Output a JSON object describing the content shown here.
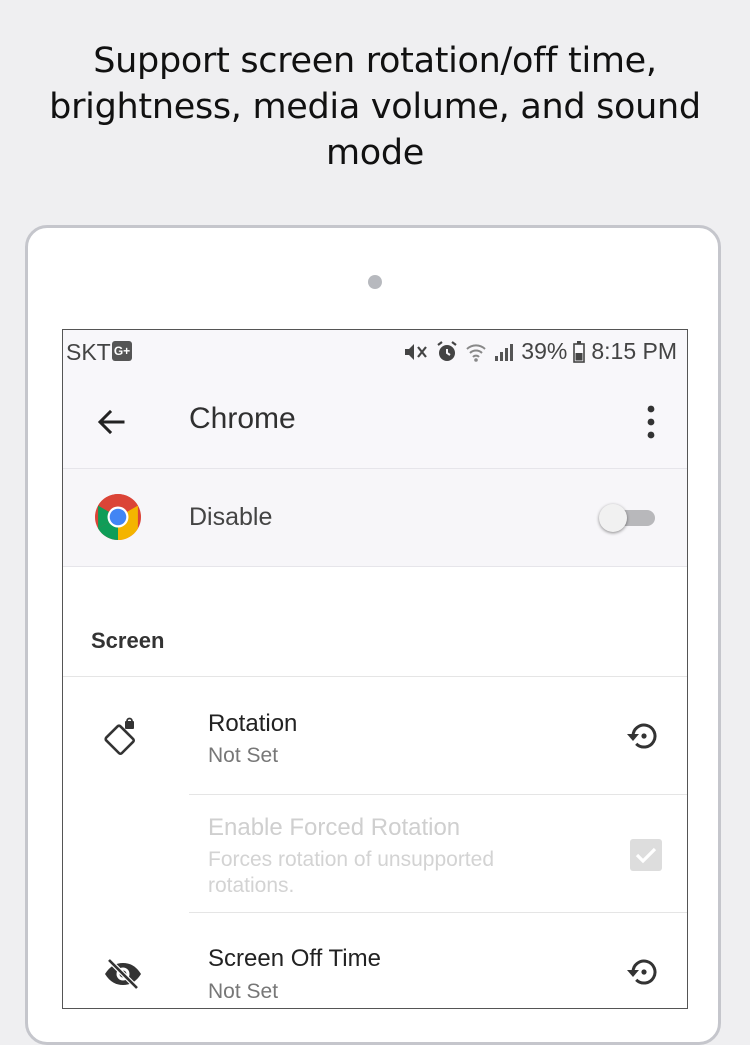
{
  "caption": "Support screen rotation/off time,\nbrightness, media volume, and sound\nmode",
  "status_bar": {
    "carrier": "SKT",
    "carrier_badge": "G+",
    "battery": "39%",
    "time": "8:15 PM"
  },
  "app_bar": {
    "title": "Chrome",
    "back_icon": "arrow-left-icon",
    "more_icon": "more-vert-icon"
  },
  "app_row": {
    "label": "Disable",
    "toggle_on": false,
    "icon": "chrome-logo-icon"
  },
  "sections": {
    "screen": {
      "header": "Screen",
      "rotation": {
        "title": "Rotation",
        "summary": "Not Set"
      },
      "forced_rotation": {
        "title": "Enable Forced Rotation",
        "summary": "Forces rotation of unsupported rotations.",
        "checked": true,
        "enabled": false
      },
      "screen_off_time": {
        "title": "Screen Off Time",
        "summary": "Not Set"
      }
    }
  },
  "colors": {
    "background": "#efeff1",
    "app_bar": "#f8f7fa",
    "toggle_track": "#b8b8bb",
    "disabled_text": "#cfcfcf"
  }
}
